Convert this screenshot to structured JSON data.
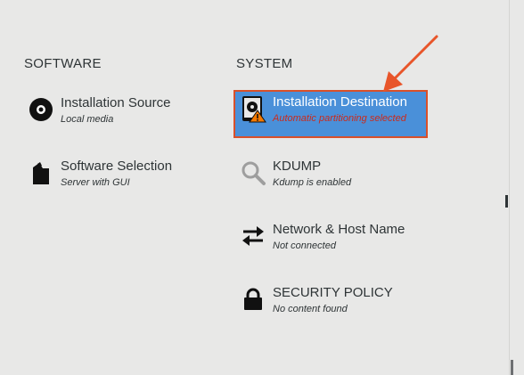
{
  "sections": {
    "software": "SOFTWARE",
    "system": "SYSTEM"
  },
  "software_items": [
    {
      "title": "Installation Source",
      "status": "Local media",
      "icon": "disc-icon"
    },
    {
      "title": "Software Selection",
      "status": "Server with GUI",
      "icon": "package-icon"
    }
  ],
  "system_items": [
    {
      "title": "Installation Destination",
      "status": "Automatic partitioning selected",
      "icon": "hard-drive-warning-icon",
      "selected": true
    },
    {
      "title": "KDUMP",
      "status": "Kdump is enabled",
      "icon": "magnifier-icon"
    },
    {
      "title": "Network & Host Name",
      "status": "Not connected",
      "icon": "network-arrows-icon"
    },
    {
      "title": "SECURITY POLICY",
      "status": "No content found",
      "icon": "lock-icon"
    }
  ],
  "colors": {
    "background": "#e8e8e7",
    "selected_fill": "#4a90d9",
    "selected_border": "#d9502a",
    "warning_status": "#cc2a1a",
    "annotation_arrow": "#e8552a",
    "text": "#2e3436"
  }
}
